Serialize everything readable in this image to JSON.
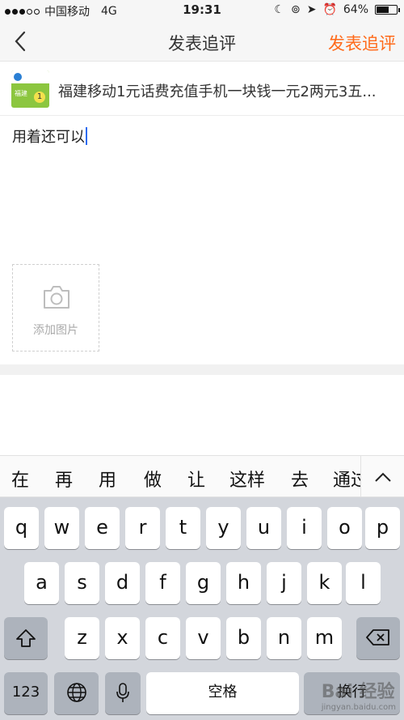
{
  "status_bar": {
    "carrier": "中国移动",
    "network": "4G",
    "time": "19:31",
    "battery": "64%",
    "battery_level": 0.64
  },
  "nav": {
    "title": "发表追评",
    "submit_label": "发表追评",
    "accent_color": "#ff6a1a"
  },
  "product": {
    "title": "福建移动1元话费充值手机一块钱一元2两元3五...",
    "thumb_text": "福建",
    "thumb_badge": "1"
  },
  "review": {
    "text": "用着还可以"
  },
  "add_photo": {
    "label": "添加图片",
    "icon": "camera-icon"
  },
  "suggestions": [
    "在",
    "再",
    "用",
    "做",
    "让",
    "这样",
    "去",
    "通过"
  ],
  "keyboard": {
    "row1": [
      "q",
      "w",
      "e",
      "r",
      "t",
      "y",
      "u",
      "i",
      "o",
      "p"
    ],
    "row2": [
      "a",
      "s",
      "d",
      "f",
      "g",
      "h",
      "j",
      "k",
      "l"
    ],
    "row3": [
      "z",
      "x",
      "c",
      "v",
      "b",
      "n",
      "m"
    ],
    "numbers_key": "123",
    "space_key": "空格",
    "return_key": "换行"
  },
  "watermark": {
    "brand": "Bai 经验",
    "url": "jingyan.baidu.com"
  }
}
